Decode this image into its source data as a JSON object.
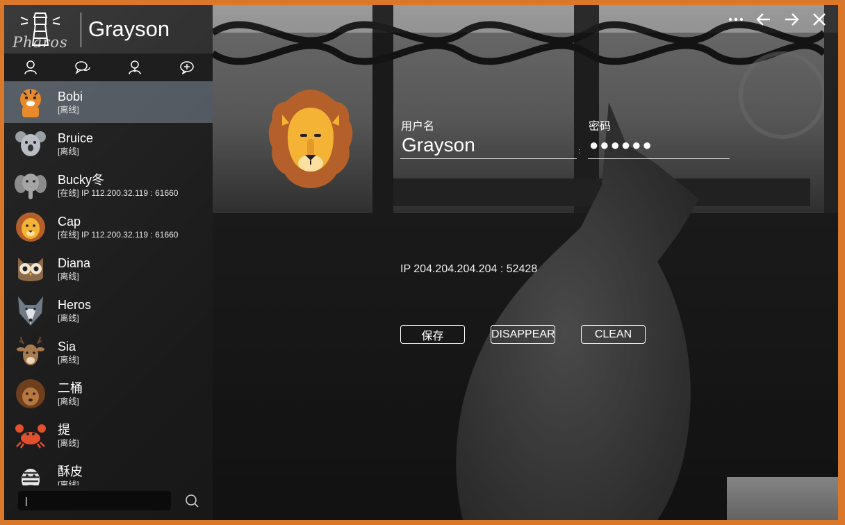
{
  "app": {
    "title": "Grayson",
    "logo_text": "Pharos"
  },
  "window_controls": [
    "more-icon",
    "back-icon",
    "forward-icon",
    "close-icon"
  ],
  "tabs": [
    "contact-icon",
    "chat-icon",
    "group-icon",
    "chat-add-icon"
  ],
  "contacts": [
    {
      "name": "Bobi",
      "status": "[离线]",
      "avatar": "tiger",
      "selected": true
    },
    {
      "name": "Bruice",
      "status": "[离线]",
      "avatar": "koala"
    },
    {
      "name": "Bucky冬",
      "status": "[在线] IP 112.200.32.119 : 61660",
      "avatar": "elephant"
    },
    {
      "name": "Cap",
      "status": "[在线] IP 112.200.32.119 : 61660",
      "avatar": "lion"
    },
    {
      "name": "Diana",
      "status": "[离线]",
      "avatar": "owl"
    },
    {
      "name": "Heros",
      "status": "[离线]",
      "avatar": "wolf"
    },
    {
      "name": "Sia",
      "status": "[离线]",
      "avatar": "deer"
    },
    {
      "name": "二桶",
      "status": "[离线]",
      "avatar": "hedgehog"
    },
    {
      "name": "提",
      "status": "[离线]",
      "avatar": "crab"
    },
    {
      "name": "酥皮",
      "status": "[离线]",
      "avatar": "zebra"
    }
  ],
  "search": {
    "value": "|",
    "placeholder": ""
  },
  "login": {
    "username_label": "用户名",
    "username_value": "Grayson",
    "password_label": "密码",
    "password_value": "●●●●●●",
    "separator": ":",
    "ip_text": "IP 204.204.204.204 : 52428"
  },
  "buttons": {
    "save": "保存",
    "disappear": "DISAPPEAR",
    "clean": "CLEAN"
  },
  "colors": {
    "frame_border": "#d9772a",
    "lion_mane": "#b5602a",
    "lion_face": "#f5b335"
  }
}
